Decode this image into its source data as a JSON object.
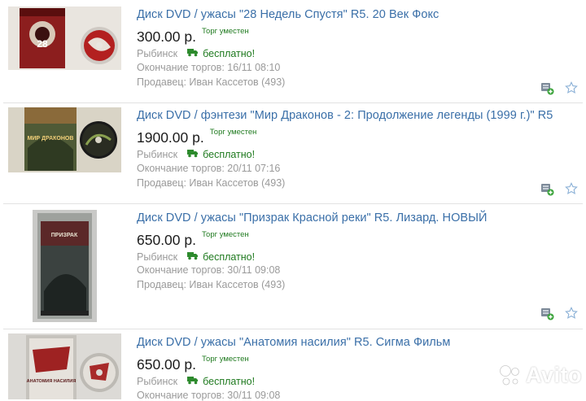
{
  "colors": {
    "title_link": "#3a6fa8",
    "price": "#1c1c1c",
    "green": "#1f7a1f",
    "muted": "#9a9a9a",
    "separator": "#e2e2e2"
  },
  "listings": [
    {
      "title": "Диск DVD / ужасы \"28 Недель Спустя\" R5. 20 Век Фокс",
      "price": "300.00 р.",
      "haggle": "Торг уместен",
      "city": "Рыбинск",
      "shipping": "бесплатно!",
      "end": "Окончание торгов: 16/11 08:10",
      "seller": "Продавец: Иван Кассетов (493)",
      "cover_text": "28"
    },
    {
      "title": "Диск DVD / фэнтези \"Мир Драконов - 2: Продолжение легенды (1999 г.)\" R5",
      "price": "1900.00 р.",
      "haggle": "Торг уместен",
      "city": "Рыбинск",
      "shipping": "бесплатно!",
      "end": "Окончание торгов: 20/11 07:16",
      "seller": "Продавец: Иван Кассетов (493)",
      "cover_text": "МИР ДРАКОНОВ"
    },
    {
      "title": "Диск DVD / ужасы \"Призрак Красной реки\" R5. Лизард. НОВЫЙ",
      "price": "650.00 р.",
      "haggle": "Торг уместен",
      "city": "Рыбинск",
      "shipping": "бесплатно!",
      "end": "Окончание торгов: 30/11 09:08",
      "seller": "Продавец: Иван Кассетов (493)",
      "cover_text": "ПРИЗРАК"
    },
    {
      "title": "Диск DVD / ужасы \"Анатомия насилия\" R5. Сигма Фильм",
      "price": "650.00 р.",
      "haggle": "Торг уместен",
      "city": "Рыбинск",
      "shipping": "бесплатно!",
      "end": "Окончание торгов: 30/11 09:08",
      "seller": "",
      "cover_text": "АНАТОМИЯ НАСИЛИЯ"
    }
  ],
  "icons": {
    "compare": "compare-icon",
    "favorite": "star-icon",
    "shipping": "truck-icon"
  },
  "watermark": {
    "text": "Avito"
  }
}
